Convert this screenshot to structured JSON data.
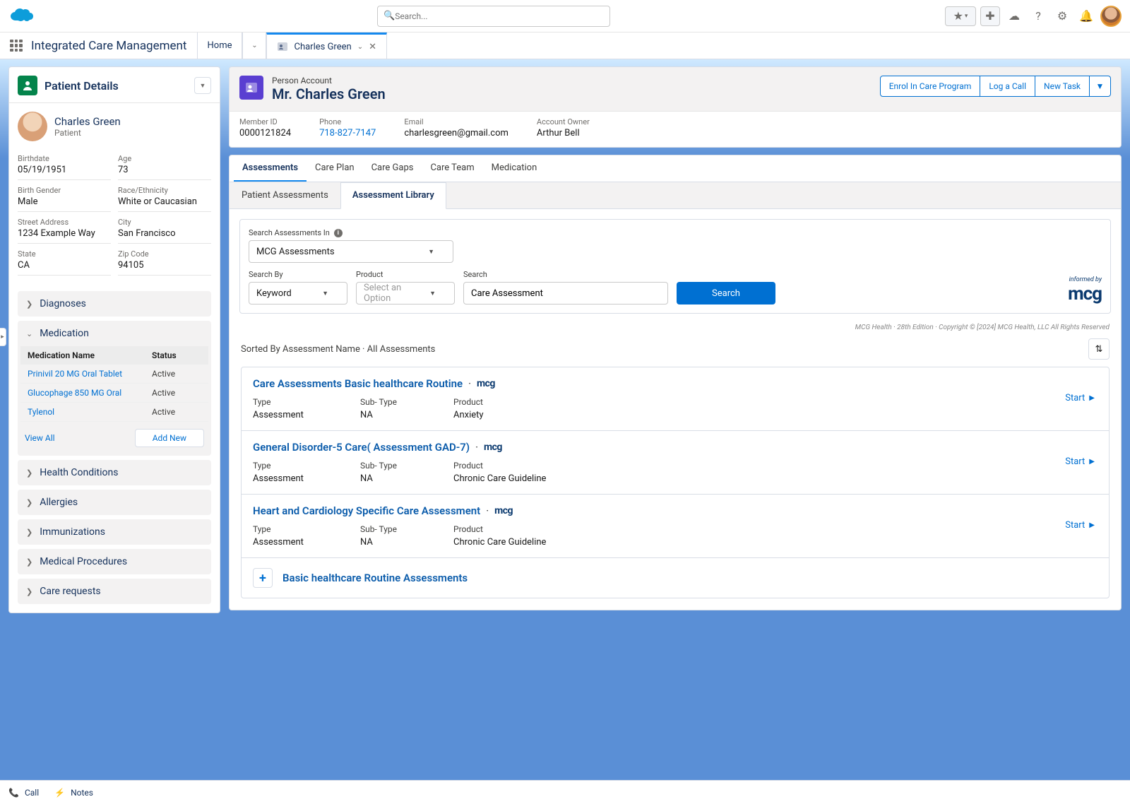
{
  "globalSearch": {
    "placeholder": "Search..."
  },
  "appName": "Integrated Care Management",
  "navTabs": {
    "home": "Home",
    "record": "Charles Green"
  },
  "sidebar": {
    "title": "Patient Details",
    "patientName": "Charles Green",
    "patientRole": "Patient",
    "fields": {
      "birthdateLabel": "Birthdate",
      "birthdate": "05/19/1951",
      "ageLabel": "Age",
      "age": "73",
      "genderLabel": "Birth Gender",
      "gender": "Male",
      "raceLabel": "Race/Ethnicity",
      "race": "White or Caucasian",
      "streetLabel": "Street Address",
      "street": "1234 Example Way",
      "cityLabel": "City",
      "city": "San Francisco",
      "stateLabel": "State",
      "state": "CA",
      "zipLabel": "Zip Code",
      "zip": "94105"
    },
    "accordions": {
      "diagnoses": "Diagnoses",
      "medication": "Medication",
      "healthConditions": "Health Conditions",
      "allergies": "Allergies",
      "immunizations": "Immunizations",
      "procedures": "Medical Procedures",
      "careRequests": "Care requests"
    },
    "medTable": {
      "hName": "Medication Name",
      "hStatus": "Status",
      "rows": [
        {
          "name": "Prinivil 20 MG Oral Tablet",
          "status": "Active"
        },
        {
          "name": "Glucophage 850 MG Oral",
          "status": "Active"
        },
        {
          "name": "Tylenol",
          "status": "Active"
        }
      ],
      "viewAll": "View All",
      "addNew": "Add New"
    }
  },
  "record": {
    "objectLabel": "Person Account",
    "title": "Mr. Charles Green",
    "actions": {
      "enrol": "Enrol In Care Program",
      "log": "Log a Call",
      "task": "New Task"
    },
    "fields": {
      "memberIdLabel": "Member ID",
      "memberId": "0000121824",
      "phoneLabel": "Phone",
      "phone": "718-827-7147",
      "emailLabel": "Email",
      "email": "charlesgreen@gmail.com",
      "ownerLabel": "Account Owner",
      "owner": "Arthur Bell"
    }
  },
  "tabs": {
    "assessments": "Assessments",
    "carePlan": "Care Plan",
    "careGaps": "Care Gaps",
    "careTeam": "Care Team",
    "medication": "Medication"
  },
  "subtabs": {
    "patient": "Patient Assessments",
    "library": "Assessment Library"
  },
  "searchPanel": {
    "searchInLabel": "Search Assessments In",
    "searchInValue": "MCG Assessments",
    "searchByLabel": "Search By",
    "searchByValue": "Keyword",
    "productLabel": "Product",
    "productPlaceholder": "Select an Option",
    "searchLabel": "Search",
    "searchValue": "Care Assessment",
    "searchBtn": "Search",
    "mcgInformed": "informed by",
    "mcgBrand": "mcg"
  },
  "copyright": "MCG Health · 28th Edition · Copyright © [2024] MCG Health, LLC All Rights Reserved",
  "sortText": "Sorted By Assessment Name · All Assessments",
  "assessments": [
    {
      "title": "Care Assessments Basic healthcare Routine",
      "typeLabel": "Type",
      "type": "Assessment",
      "subTypeLabel": "Sub- Type",
      "subType": "NA",
      "productLabel": "Product",
      "product": "Anxiety",
      "start": "Start"
    },
    {
      "title": "General Disorder-5 Care( Assessment GAD-7)",
      "typeLabel": "Type",
      "type": "Assessment",
      "subTypeLabel": "Sub- Type",
      "subType": "NA",
      "productLabel": "Product",
      "product": "Chronic Care Guideline",
      "start": "Start"
    },
    {
      "title": "Heart and Cardiology Specific Care Assessment",
      "typeLabel": "Type",
      "type": "Assessment",
      "subTypeLabel": "Sub- Type",
      "subType": "NA",
      "productLabel": "Product",
      "product": "Chronic Care Guideline",
      "start": "Start"
    }
  ],
  "compactRow": {
    "title": "Basic healthcare Routine Assessments"
  },
  "bottomBar": {
    "call": "Call",
    "notes": "Notes"
  }
}
